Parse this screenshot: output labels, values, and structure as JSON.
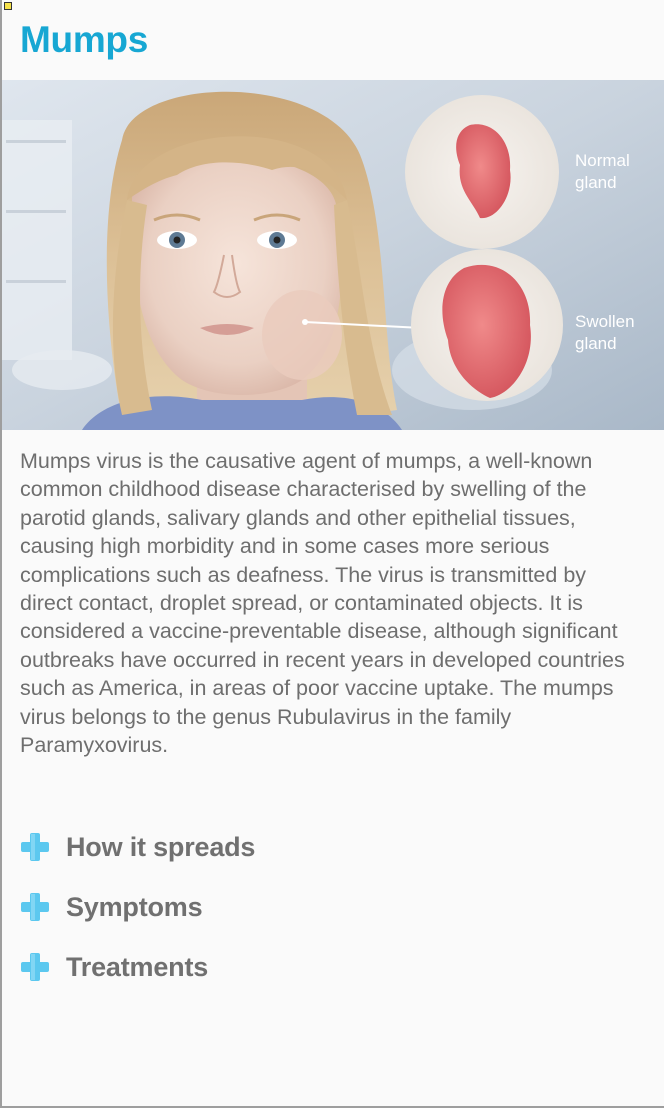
{
  "page": {
    "title": "Mumps"
  },
  "hero_image": {
    "alt": "Illustration of a child with a swollen parotid gland",
    "label_normal_line1": "Normal",
    "label_normal_line2": "gland",
    "label_swollen_line1": "Swollen",
    "label_swollen_line2": "gland"
  },
  "description": "Mumps virus is the causative agent of mumps, a well-known common childhood disease characterised by swelling of the parotid glands, salivary glands and other epithelial tissues, causing high morbidity and in some cases more serious complications such as deafness. The virus is transmitted by direct contact, droplet spread, or contaminated objects. It is considered a vaccine-preventable disease, although significant outbreaks have occurred in recent years in developed countries such as America, in areas of poor vaccine uptake. The mumps virus belongs to the genus Rubulavirus in the family Paramyxovirus.",
  "sections": [
    {
      "label": "How it spreads",
      "icon": "plus-icon"
    },
    {
      "label": "Symptoms",
      "icon": "plus-icon"
    },
    {
      "label": "Treatments",
      "icon": "plus-icon"
    }
  ],
  "colors": {
    "title": "#17a7d3",
    "body_text": "#6e6e6e",
    "section_text": "#707070",
    "plus_icon": "#5cc8ef",
    "background": "#fafafa"
  }
}
